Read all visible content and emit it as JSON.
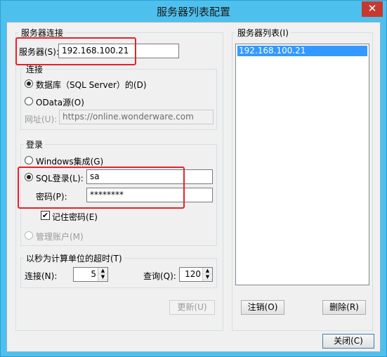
{
  "window": {
    "title": "服务器列表配置",
    "close_glyph": "✕"
  },
  "server_connection": {
    "group_title": "服务器连接",
    "server_label": "服务器(S):",
    "server_value": "192.168.100.21",
    "connection": {
      "group_title": "连接",
      "db_option": "数据库（SQL Server）的(D)",
      "odata_option": "OData源(O)",
      "url_label": "网址(U):",
      "url_placeholder": "https://online.wonderware.com"
    },
    "login": {
      "group_title": "登录",
      "windows_option": "Windows集成(G)",
      "sql_option": "SQL登录(L):",
      "sql_user": "sa",
      "password_label": "密码(P):",
      "password_value": "********",
      "remember_label": "记住密码(E)",
      "remember_checked": true,
      "admin_option": "管理账户(M)"
    },
    "timeout": {
      "group_title": "以秒为计算单位的超时(T)",
      "connect_label": "连接(N):",
      "connect_value": "5",
      "query_label": "查询(Q):",
      "query_value": "120"
    },
    "refresh_button": "更新(U)"
  },
  "server_list": {
    "group_title": "服务器列表(I)",
    "items": [
      "192.168.100.21"
    ],
    "logout_button": "注销(O)",
    "delete_button": "删除(R)"
  },
  "close_button": "关闭(C)",
  "colors": {
    "title_bar": "#4ec0ee",
    "selection": "#3399ff",
    "highlight_box": "#e8202a"
  }
}
